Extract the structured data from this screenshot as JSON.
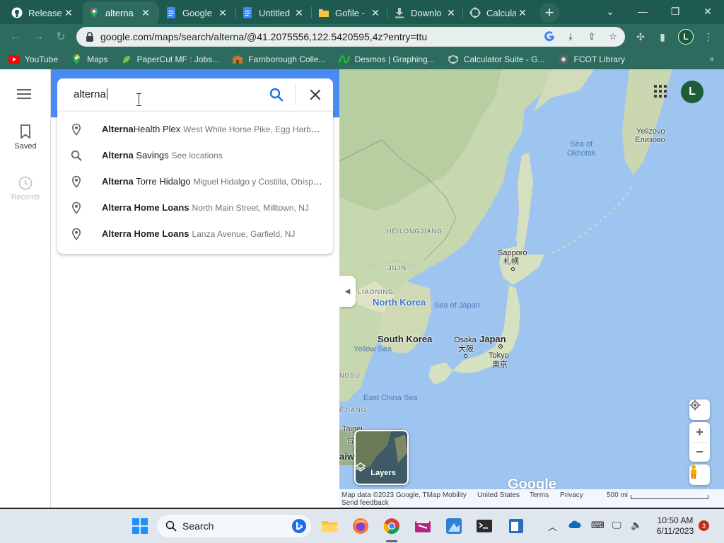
{
  "browser": {
    "tabs": [
      {
        "title": "Release",
        "icon": "github-icon"
      },
      {
        "title": "alterna",
        "icon": "google-maps-icon"
      },
      {
        "title": "Google",
        "icon": "google-docs-icon"
      },
      {
        "title": "Untitled",
        "icon": "google-docs-icon"
      },
      {
        "title": "Gofile -",
        "icon": "gofile-icon"
      },
      {
        "title": "Downlo",
        "icon": "download-icon"
      },
      {
        "title": "Calcula",
        "icon": "calculator-icon"
      }
    ],
    "active_tab_index": 1,
    "url": "google.com/maps/search/alterna/@41.2075556,122.5420595,4z?entry=ttu",
    "profile_initial": "L",
    "colors": {
      "frame": "#1f5a50",
      "toolbar": "#2d6b5f"
    }
  },
  "bookmarks": [
    {
      "label": "YouTube",
      "icon": "youtube-icon"
    },
    {
      "label": "Maps",
      "icon": "maps-icon"
    },
    {
      "label": "PaperCut MF : Jobs...",
      "icon": "papercut-icon"
    },
    {
      "label": "Farnborough Colle...",
      "icon": "college-icon"
    },
    {
      "label": "Desmos | Graphing...",
      "icon": "desmos-icon"
    },
    {
      "label": "Calculator Suite - G...",
      "icon": "geogebra-icon"
    },
    {
      "label": "FCOT Library",
      "icon": "library-icon"
    }
  ],
  "maps": {
    "rail": {
      "saved_label": "Saved",
      "recents_label": "Recents"
    },
    "search": {
      "query": "alterna"
    },
    "suggestions": [
      {
        "icon": "place-pin-icon",
        "bold": "Alterna",
        "normal": "Health Plex",
        "secondary": "West White Horse Pike, Egg Harbor ..."
      },
      {
        "icon": "search-icon",
        "bold": "Alterna",
        "normal": " Savings",
        "secondary": "See locations"
      },
      {
        "icon": "place-pin-icon",
        "bold": "Alterna",
        "normal": " Torre Hidalgo",
        "secondary": "Miguel Hidalgo y Costilla, Obispa..."
      },
      {
        "icon": "place-pin-icon",
        "bold": "Alterra Home Loans",
        "normal": "",
        "secondary": "North Main Street, Milltown, NJ"
      },
      {
        "icon": "place-pin-icon",
        "bold": "Alterra Home Loans",
        "normal": "",
        "secondary": "Lanza Avenue, Garfield, NJ"
      }
    ],
    "map_labels": {
      "sea_of_okhotsk": "Sea of\nOkhotsk",
      "yelizovo": "Yelizovo",
      "yelizovo_ru": "Елизово",
      "heilongjiang": "HEILONGJIANG",
      "jilin": "JILIN",
      "liaoning": "LIAONING",
      "sapporo": "Sapporo",
      "sapporo_jp": "札幌",
      "north_korea": "North Korea",
      "sea_of_japan": "Sea of Japan",
      "south_korea": "South Korea",
      "yellow_sea": "Yellow Sea",
      "osaka": "Osaka",
      "osaka_jp": "大阪",
      "japan": "Japan",
      "tokyo": "Tokyo",
      "tokyo_jp": "東京",
      "east_china_sea": "East China Sea",
      "jiangsu_fragment": "NGSU",
      "zhejiang_fragment": "EJIANG",
      "taipei_fragment": "Taipei",
      "taiwan_fragment": "aiwa",
      "taipei_jp_fragment": "台"
    },
    "account_initial": "L",
    "layers_label": "Layers",
    "logo_text": "Google",
    "footer": {
      "attribution": "Map data ©2023 Google, TMap Mobility",
      "region": "United States",
      "terms": "Terms",
      "privacy": "Privacy",
      "feedback": "Send feedback",
      "scale": "500 mi"
    }
  },
  "taskbar": {
    "search_label": "Search",
    "time": "10:50 AM",
    "date": "6/11/2023",
    "notification_count": "3"
  }
}
